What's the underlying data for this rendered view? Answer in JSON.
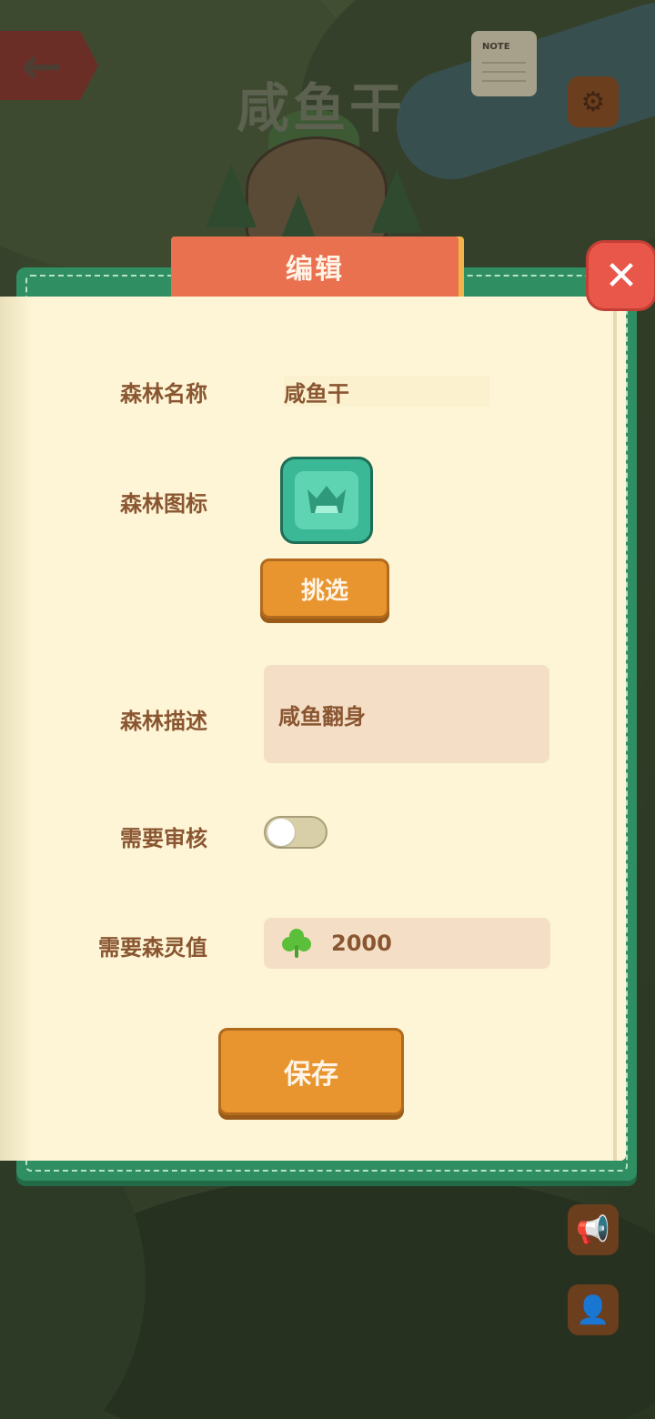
{
  "scene": {
    "title": "咸鱼干",
    "note_label": "NOTE",
    "back_icon": "←",
    "gear_icon": "⚙",
    "megaphone_icon": "📢",
    "profile_icon": "👤"
  },
  "dialog": {
    "title": "编辑",
    "close_label": "✕"
  },
  "form": {
    "name_label": "森林名称",
    "name_value": "咸鱼干",
    "icon_label": "森林图标",
    "pick_button": "挑选",
    "desc_label": "森林描述",
    "desc_value": "咸鱼翻身",
    "review_label": "需要审核",
    "review_enabled": false,
    "spirit_label": "需要森灵值",
    "spirit_value": "2000",
    "save_button": "保存"
  },
  "colors": {
    "frame_green": "#2f8f62",
    "paper": "#fdf5d5",
    "tab_orange": "#e9714f",
    "close_red": "#e9574a",
    "wood_orange": "#e8952f",
    "label_brown": "#8a5632",
    "clover_green": "#5bbf3a"
  }
}
